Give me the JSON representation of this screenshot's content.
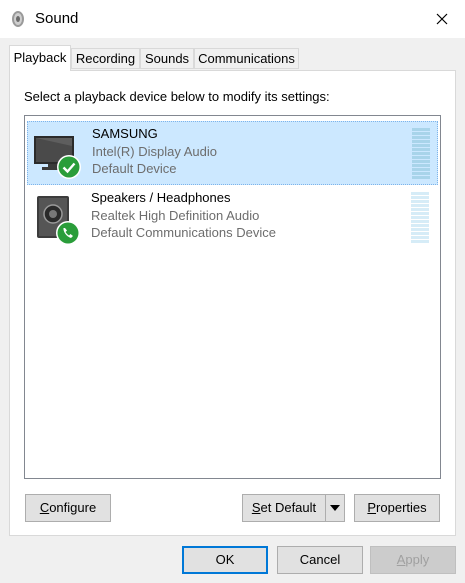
{
  "window": {
    "title": "Sound"
  },
  "tabs": [
    {
      "label": "Playback"
    },
    {
      "label": "Recording"
    },
    {
      "label": "Sounds"
    },
    {
      "label": "Communications"
    }
  ],
  "playback": {
    "instruction": "Select a playback device below to modify its settings:",
    "devices": [
      {
        "name": "SAMSUNG",
        "driver": "Intel(R) Display Audio",
        "status": "Default Device",
        "icon": "monitor-icon",
        "badge": "checkmark-badge-icon",
        "selected": true
      },
      {
        "name": "Speakers / Headphones",
        "driver": "Realtek High Definition Audio",
        "status": "Default Communications Device",
        "icon": "speaker-icon",
        "badge": "phone-badge-icon",
        "selected": false
      }
    ]
  },
  "buttons": {
    "configure_prefix": "",
    "configure_mnemonic": "C",
    "configure_rest": "onfigure",
    "set_default_mnemonic": "S",
    "set_default_rest": "et Default",
    "properties_mnemonic": "P",
    "properties_rest": "roperties",
    "ok": "OK",
    "cancel": "Cancel",
    "apply_mnemonic": "A",
    "apply_rest": "pply"
  },
  "colors": {
    "selection": "#cce8ff",
    "badge_green": "#2a9d3a",
    "primary_border": "#0078d7"
  }
}
